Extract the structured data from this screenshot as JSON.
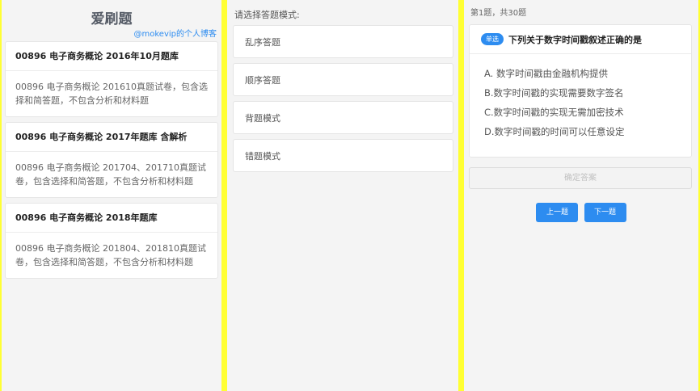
{
  "panel1": {
    "title": "爱刷题",
    "blog_link": "@mokevip的个人博客",
    "banks": [
      {
        "title": "00896 电子商务概论 2016年10月题库",
        "desc": "00896 电子商务概论 201610真题试卷，包含选择和简答题，不包含分析和材料题"
      },
      {
        "title": "00896 电子商务概论 2017年题库 含解析",
        "desc": "00896 电子商务概论 201704、201710真题试卷，包含选择和简答题，不包含分析和材料题"
      },
      {
        "title": "00896 电子商务概论 2018年题库",
        "desc": "00896 电子商务概论 201804、201810真题试卷，包含选择和简答题，不包含分析和材料题"
      }
    ]
  },
  "panel2": {
    "prompt": "请选择答题模式:",
    "modes": [
      "乱序答题",
      "顺序答题",
      "背题模式",
      "错题模式"
    ]
  },
  "panel3": {
    "progress": "第1题，共30题",
    "badge": "单选",
    "question": "下列关于数字时间戳叙述正确的是",
    "options": [
      "A. 数字时间戳由金融机构提供",
      "B.数字时间戳的实现需要数字签名",
      "C.数字时间戳的实现无需加密技术",
      "D.数字时间戳的时间可以任意设定"
    ],
    "confirm_label": "确定答案",
    "prev_label": "上一题",
    "next_label": "下一题"
  },
  "colors": {
    "divider": "#ffff33",
    "accent": "#2d8cf0"
  }
}
